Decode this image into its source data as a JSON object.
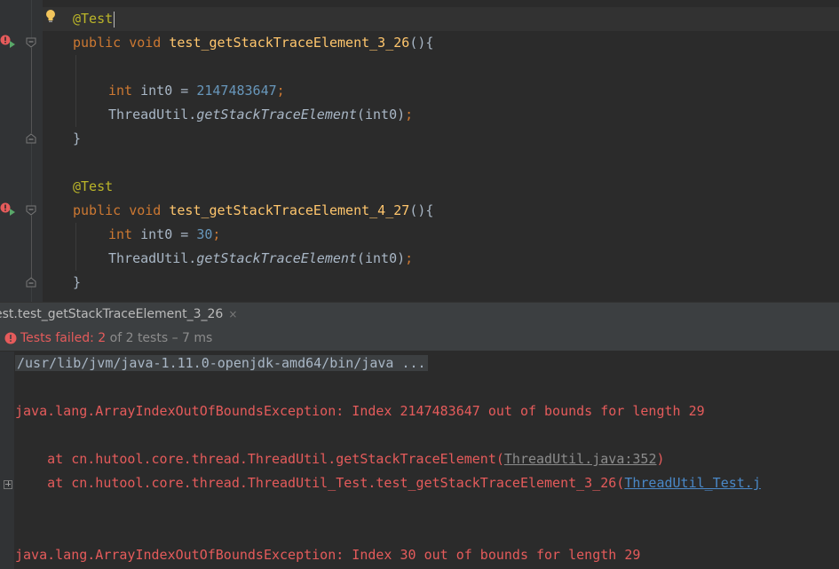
{
  "editor": {
    "lines": [
      {
        "annotation": "@Test"
      },
      {
        "kw1": "public",
        "kw2": "void",
        "method": "test_getStackTraceElement_3_26",
        "rest": "(){"
      },
      {},
      {
        "type": "int",
        "var": "int0",
        "eq": " = ",
        "value": "2147483647",
        "semi": ";"
      },
      {
        "cls": "ThreadUtil.",
        "call": "getStackTraceElement",
        "args": "(int0)",
        "semi": ";"
      },
      {
        "brace": "}"
      },
      {},
      {
        "annotation": "@Test"
      },
      {
        "kw1": "public",
        "kw2": "void",
        "method": "test_getStackTraceElement_4_27",
        "rest": "(){"
      },
      {
        "type": "int",
        "var": "int0",
        "eq": " = ",
        "value": "30",
        "semi": ";"
      },
      {
        "cls": "ThreadUtil.",
        "call": "getStackTraceElement",
        "args": "(int0)",
        "semi": ";"
      },
      {
        "brace": "}"
      }
    ]
  },
  "run_panel": {
    "tab_label": "est.test_getStackTraceElement_3_26",
    "tab_close": "×",
    "status": {
      "failed_label": "Tests failed: 2",
      "rest": " of 2 tests – 7 ms"
    },
    "console": {
      "command": "/usr/lib/jvm/java-1.11.0-openjdk-amd64/bin/java ...",
      "exception1": "java.lang.ArrayIndexOutOfBoundsException: Index 2147483647 out of bounds for length 29",
      "trace1_prefix": "    at cn.hutool.core.thread.ThreadUtil.getStackTraceElement(",
      "trace1_link": "ThreadUtil.java:352",
      "trace1_suffix": ")",
      "trace2_prefix": "    at cn.hutool.core.thread.ThreadUtil_Test.test_getStackTraceElement_3_26(",
      "trace2_link": "ThreadUtil_Test.j",
      "exception2": "java.lang.ArrayIndexOutOfBoundsException: Index 30 out of bounds for length 29"
    }
  },
  "colors": {
    "background": "#2b2b2b",
    "keyword": "#cc7832",
    "annotation": "#bbb529",
    "method": "#ffc66d",
    "number": "#6897bb",
    "error": "#e55b5b",
    "link": "#4a88c7"
  }
}
